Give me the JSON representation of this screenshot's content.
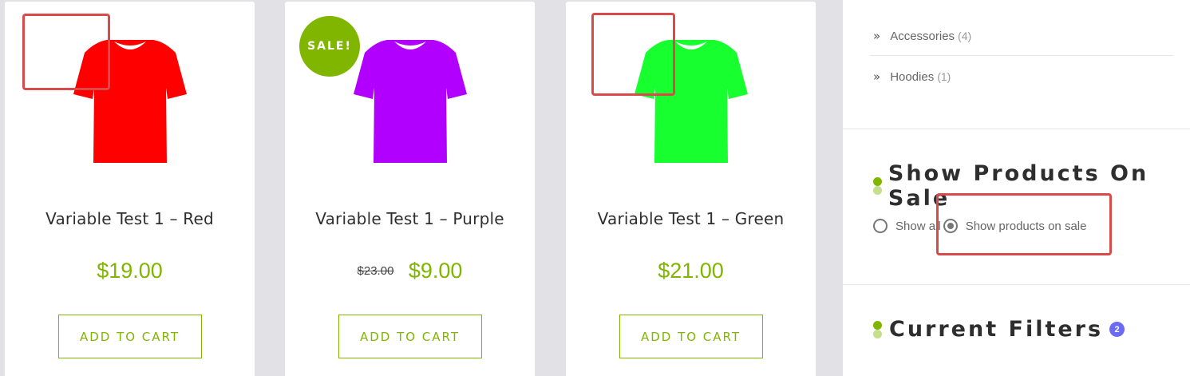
{
  "products": [
    {
      "title": "Variable Test 1 – Red",
      "price": "$19.00",
      "old_price": "",
      "sale_badge": "",
      "color": "#ff0000",
      "add_to_cart": "ADD TO CART"
    },
    {
      "title": "Variable Test 1 – Purple",
      "price": "$9.00",
      "old_price": "$23.00",
      "sale_badge": "SALE!",
      "color": "#b200ff",
      "add_to_cart": "ADD TO CART"
    },
    {
      "title": "Variable Test 1 – Green",
      "price": "$21.00",
      "old_price": "",
      "sale_badge": "",
      "color": "#17ff2e",
      "add_to_cart": "ADD TO CART"
    }
  ],
  "sidebar": {
    "categories": [
      {
        "label": "Accessories",
        "count": "(4)"
      },
      {
        "label": "Hoodies",
        "count": "(1)"
      }
    ],
    "sale_widget": {
      "title": "Show Products On Sale",
      "options": [
        {
          "label": "Show all",
          "checked": false
        },
        {
          "label": "Show products on sale",
          "checked": true
        }
      ]
    },
    "filters_widget": {
      "title": "Current Filters",
      "badge": "2"
    }
  },
  "colors": {
    "accent": "#80b500",
    "highlight": "#d94a4a",
    "badge": "#6a6af5"
  },
  "icons": [
    "tshirt-icon",
    "chevrons-right-icon",
    "radio-icon"
  ]
}
